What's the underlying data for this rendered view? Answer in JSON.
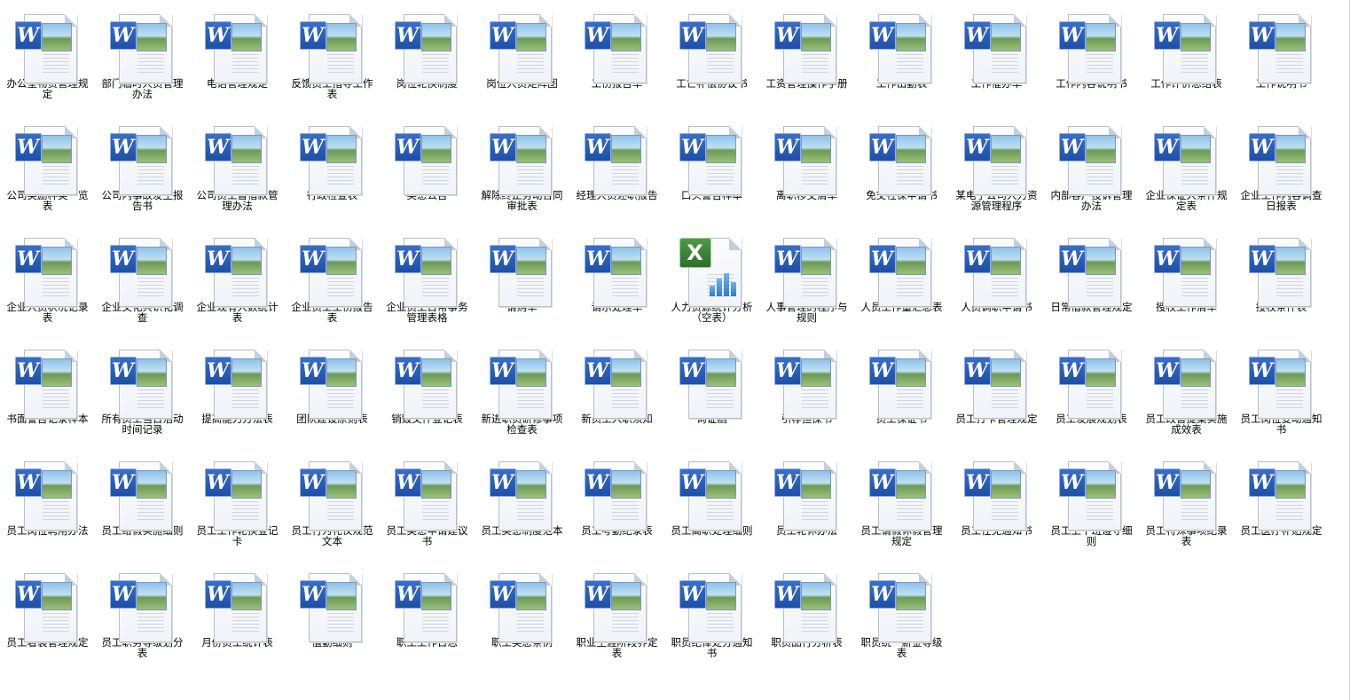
{
  "files": [
    {
      "name": "办公室物资管理规定",
      "type": "word"
    },
    {
      "name": "部门临时人员管理办法",
      "type": "word"
    },
    {
      "name": "电话管理规定",
      "type": "word"
    },
    {
      "name": "反馈员工指导工作表",
      "type": "word"
    },
    {
      "name": "岗位轮换制度",
      "type": "word"
    },
    {
      "name": "岗位人员矩阵图",
      "type": "word"
    },
    {
      "name": "工伤报告单",
      "type": "word"
    },
    {
      "name": "工亡补偿协议书",
      "type": "word"
    },
    {
      "name": "工资管理操作手册",
      "type": "word"
    },
    {
      "name": "工作出勤表",
      "type": "word"
    },
    {
      "name": "工作催办单",
      "type": "word"
    },
    {
      "name": "工作内容说明书",
      "type": "word"
    },
    {
      "name": "工作评价总结表",
      "type": "word"
    },
    {
      "name": "工作说明书",
      "type": "word"
    },
    {
      "name": "公司奖励种类一览表",
      "type": "word"
    },
    {
      "name": "公司内事故发生报告书",
      "type": "word"
    },
    {
      "name": "公司员工暂借款管理办法",
      "type": "word"
    },
    {
      "name": "行政检查表",
      "type": "word"
    },
    {
      "name": "奖惩公告",
      "type": "word"
    },
    {
      "name": "解除终止劳动合同审批表",
      "type": "word"
    },
    {
      "name": "经理人员述职报告",
      "type": "word"
    },
    {
      "name": "口头警告样本",
      "type": "word"
    },
    {
      "name": "离职移交清单",
      "type": "word"
    },
    {
      "name": "免交社保申请书",
      "type": "word"
    },
    {
      "name": "某电子公司人力资源管理程序",
      "type": "word"
    },
    {
      "name": "内部客户投诉管理办法",
      "type": "word"
    },
    {
      "name": "企业保证人条件规定表",
      "type": "word"
    },
    {
      "name": "企业工作内容调查日报表",
      "type": "word"
    },
    {
      "name": "企业人员状况记录表",
      "type": "word"
    },
    {
      "name": "企业文化共识化调查",
      "type": "word"
    },
    {
      "name": "企业现有人数统计表",
      "type": "word"
    },
    {
      "name": "企业员工工伤报告表",
      "type": "word"
    },
    {
      "name": "企业员工日常事务管理表格",
      "type": "word"
    },
    {
      "name": "请购单",
      "type": "word"
    },
    {
      "name": "请示处理单",
      "type": "word"
    },
    {
      "name": "人力资源统计分析（空表）",
      "type": "excel"
    },
    {
      "name": "人事管理的程序与规则",
      "type": "word"
    },
    {
      "name": "人员工作量汇总表",
      "type": "word"
    },
    {
      "name": "人员调职申请书",
      "type": "word"
    },
    {
      "name": "日常借款管理规定",
      "type": "word"
    },
    {
      "name": "授权工作清单",
      "type": "word"
    },
    {
      "name": "授权条件表",
      "type": "word"
    },
    {
      "name": "书面警告记录样本",
      "type": "word"
    },
    {
      "name": "所有员工当日活动时间记录",
      "type": "word"
    },
    {
      "name": "提高能力方法表",
      "type": "word"
    },
    {
      "name": "团队建设原则表",
      "type": "word"
    },
    {
      "name": "销毁文件登记表",
      "type": "word"
    },
    {
      "name": "新进职员研修事项检查表",
      "type": "word"
    },
    {
      "name": "新员工入职须知",
      "type": "word"
    },
    {
      "name": "询证函",
      "type": "word"
    },
    {
      "name": "引荐担保书",
      "type": "word"
    },
    {
      "name": "员工保证书",
      "type": "word"
    },
    {
      "name": "员工打卡管理规定",
      "type": "word"
    },
    {
      "name": "员工发展规划表",
      "type": "word"
    },
    {
      "name": "员工改善提案实施成效表",
      "type": "word"
    },
    {
      "name": "员工岗位变动通知书",
      "type": "word"
    },
    {
      "name": "员工岗位聘用办法",
      "type": "word"
    },
    {
      "name": "员工给假实施细则",
      "type": "word"
    },
    {
      "name": "员工工作轮换登记卡",
      "type": "word"
    },
    {
      "name": "员工行为礼仪规范文本",
      "type": "word"
    },
    {
      "name": "员工奖惩申请建议书",
      "type": "word"
    },
    {
      "name": "员工奖惩制度范本",
      "type": "word"
    },
    {
      "name": "员工考勤纪录表",
      "type": "word"
    },
    {
      "name": "员工离职处理细则",
      "type": "word"
    },
    {
      "name": "员工轮休办法",
      "type": "word"
    },
    {
      "name": "员工请假休假管理规定",
      "type": "word"
    },
    {
      "name": "员工任免通知书",
      "type": "word"
    },
    {
      "name": "员工上下班遵守细则",
      "type": "word"
    },
    {
      "name": "员工特殊事项纪录表",
      "type": "word"
    },
    {
      "name": "员工医疗补贴规定",
      "type": "word"
    },
    {
      "name": "员工着装管理规定",
      "type": "word"
    },
    {
      "name": "员工职务等级划分表",
      "type": "word"
    },
    {
      "name": "月份员工统计表",
      "type": "word"
    },
    {
      "name": "值勤细则",
      "type": "word"
    },
    {
      "name": "职工工作日志",
      "type": "word"
    },
    {
      "name": "职工奖惩条例",
      "type": "word"
    },
    {
      "name": "职业生涯阶段界定表",
      "type": "word"
    },
    {
      "name": "职员纪律处分通知书",
      "type": "word"
    },
    {
      "name": "职员品行分析表",
      "type": "word"
    },
    {
      "name": "职员统一薪金等级表",
      "type": "word"
    }
  ],
  "icons": {
    "word": {
      "glyph": "W",
      "icon_name": "word-document-icon",
      "accent": "#1d4fa8"
    },
    "excel": {
      "glyph": "X",
      "icon_name": "excel-spreadsheet-icon",
      "accent": "#2c6e2b"
    }
  }
}
